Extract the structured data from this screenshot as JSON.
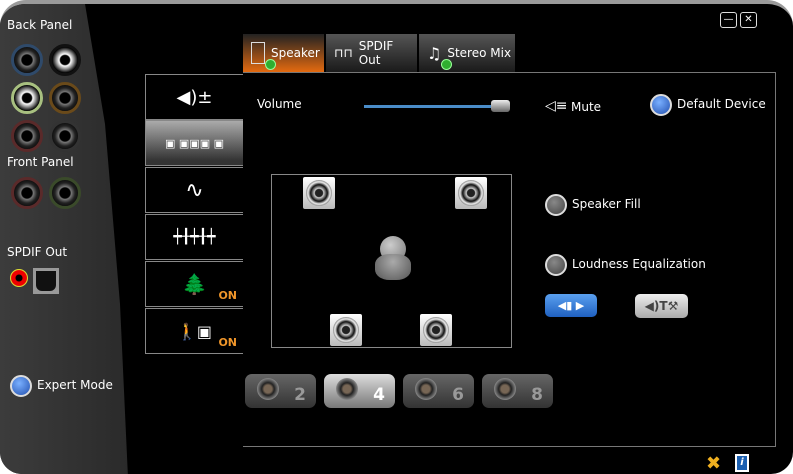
{
  "window": {
    "minimize": "—",
    "close": "✕"
  },
  "left": {
    "back_panel": "Back Panel",
    "front_panel": "Front Panel",
    "spdif_out": "SPDIF Out",
    "expert_mode": "Expert Mode"
  },
  "tabs": [
    {
      "label": "Speaker",
      "active": true
    },
    {
      "label": "SPDIF Out"
    },
    {
      "label": "Stereo Mix"
    }
  ],
  "side": {
    "on1": "ON",
    "on2": "ON"
  },
  "main": {
    "volume_label": "Volume",
    "volume_value": 100,
    "mute": "Mute",
    "default_device": "Default Device",
    "speaker_fill": "Speaker Fill",
    "loudness": "Loudness Equalization"
  },
  "channels": [
    "2",
    "4",
    "6",
    "8"
  ],
  "selected_channel": "4",
  "colors": {
    "accent": "#e46a10",
    "on": "#f0962a",
    "blue": "#2a6fd0"
  }
}
